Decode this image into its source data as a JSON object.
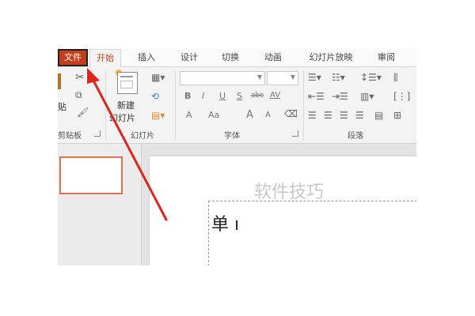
{
  "tabs": {
    "file": "文件",
    "home": "开始",
    "insert": "插入",
    "design": "设计",
    "transitions": "切换",
    "animations": "动画",
    "slideshow": "幻灯片放映",
    "review": "审阅"
  },
  "ribbon": {
    "clipboard": {
      "paste": "贴",
      "label": "剪贴板"
    },
    "slides": {
      "new_line1": "新建",
      "new_line2": "幻灯片",
      "label": "幻灯片"
    },
    "font": {
      "label": "字体",
      "bold": "B",
      "italic": "I",
      "underline": "U",
      "shadow": "S",
      "strike": "abc",
      "spacing": "AV",
      "case": "Aa",
      "grow": "A",
      "shrink": "A"
    },
    "paragraph": {
      "label": "段落"
    }
  },
  "slide": {
    "watermark": "软件技巧",
    "partial_text": "单 ı"
  },
  "colors": {
    "file_tab": "#c43e1c",
    "arrow": "#e0241b",
    "thumb_border": "#e07050"
  }
}
